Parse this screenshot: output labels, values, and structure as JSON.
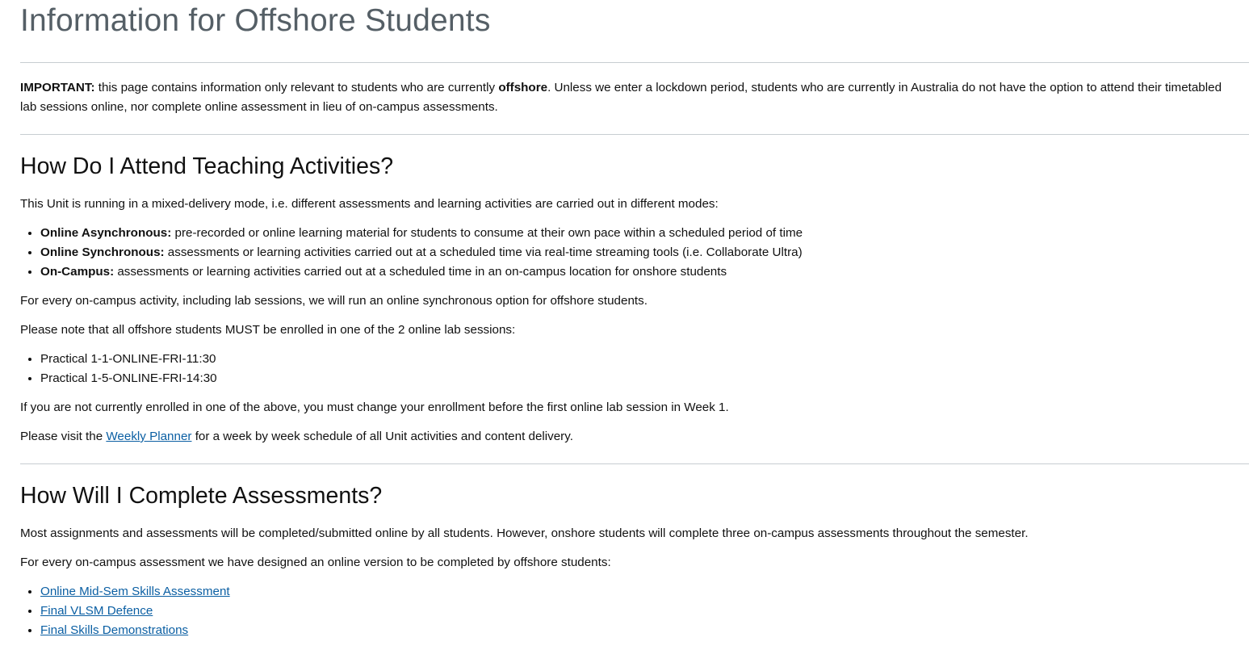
{
  "page_title": "Information for Offshore Students",
  "important": {
    "label": "IMPORTANT:",
    "text_1": " this page contains information only relevant to students who are currently ",
    "bold_word": "offshore",
    "text_2": ". Unless we enter a lockdown period, students who are currently in Australia do not have the option to attend their timetabled lab sessions online, nor complete online assessment in lieu of on-campus assessments."
  },
  "section_attend": {
    "heading": "How Do I Attend Teaching Activities?",
    "intro": "This Unit is running in a mixed-delivery mode, i.e. different assessments and learning activities are carried out in different modes:",
    "modes": [
      {
        "label": "Online Asynchronous:",
        "text": " pre-recorded or online learning material for students to consume at their own pace within a scheduled period of time"
      },
      {
        "label": "Online Synchronous:",
        "text": " assessments or learning activities carried out at a scheduled time via real-time streaming tools (i.e. Collaborate Ultra)"
      },
      {
        "label": "On-Campus:",
        "text": " assessments or learning activities carried out at a scheduled time in an on-campus location for onshore students"
      }
    ],
    "every_activity": "For every on-campus activity, including lab sessions, we will run an online synchronous option for offshore students.",
    "please_note": "Please note that all offshore students MUST be enrolled in one of the 2 online lab sessions:",
    "lab_sessions": [
      "Practical 1-1-ONLINE-FRI-11:30",
      "Practical 1-5-ONLINE-FRI-14:30"
    ],
    "enrollment_note": "If you are not currently enrolled in one of the above, you must change your enrollment before the first online lab session in Week 1.",
    "visit_prefix": "Please visit the ",
    "visit_link": "Weekly Planner",
    "visit_suffix": " for a week by week schedule of all Unit activities and content delivery."
  },
  "section_assess": {
    "heading": "How Will I Complete Assessments?",
    "intro": "Most assignments and assessments will be completed/submitted online by all students. However, onshore students will complete three on-campus assessments throughout the semester.",
    "every_assessment": "For every on-campus assessment we have designed an online version to be completed by offshore students:",
    "links": [
      "Online Mid-Sem Skills Assessment",
      "Final VLSM Defence",
      "Final Skills Demonstrations"
    ]
  },
  "colors": {
    "link": "#0b5fa3",
    "title": "#555f66",
    "rule": "#c7cdd1"
  }
}
